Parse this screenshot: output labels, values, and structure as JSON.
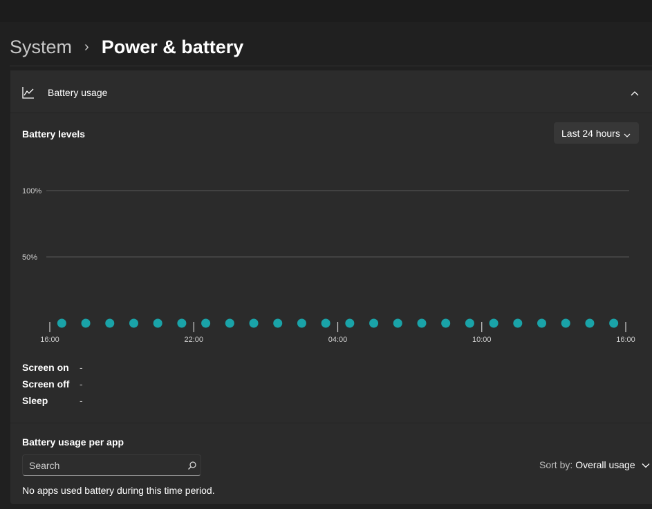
{
  "breadcrumb": {
    "parent": "System",
    "separator": "›",
    "current": "Power & battery"
  },
  "battery_usage": {
    "header_label": "Battery usage",
    "levels_title": "Battery levels",
    "time_range": "Last 24 hours"
  },
  "stats": [
    {
      "label": "Screen on",
      "value": "-"
    },
    {
      "label": "Screen off",
      "value": "-"
    },
    {
      "label": "Sleep",
      "value": "-"
    }
  ],
  "per_app": {
    "title": "Battery usage per app",
    "search_placeholder": "Search",
    "sort_label": "Sort by:",
    "sort_value": "Overall usage",
    "empty_message": "No apps used battery during this time period."
  },
  "colors": {
    "accent": "#1aa3a8",
    "background": "#202020",
    "card": "#2b2b2b"
  },
  "chart_data": {
    "type": "scatter",
    "y_tick_labels": [
      "100%",
      "50%"
    ],
    "y_ticks": [
      100,
      50
    ],
    "ylim": [
      0,
      100
    ],
    "x_tick_labels": [
      "16:00",
      "22:00",
      "04:00",
      "10:00",
      "16:00"
    ],
    "x_tick_hours": [
      0,
      6,
      12,
      18,
      24
    ],
    "xlim": [
      0,
      24
    ],
    "grid": true,
    "points_x_hours": [
      0.5,
      1.5,
      2.5,
      3.5,
      4.5,
      5.5,
      6.5,
      7.5,
      8.5,
      9.5,
      10.5,
      11.5,
      12.5,
      13.5,
      14.5,
      15.5,
      16.5,
      17.5,
      18.5,
      19.5,
      20.5,
      21.5,
      22.5,
      23.5
    ],
    "points_y": [
      0,
      0,
      0,
      0,
      0,
      0,
      0,
      0,
      0,
      0,
      0,
      0,
      0,
      0,
      0,
      0,
      0,
      0,
      0,
      0,
      0,
      0,
      0,
      0
    ]
  }
}
